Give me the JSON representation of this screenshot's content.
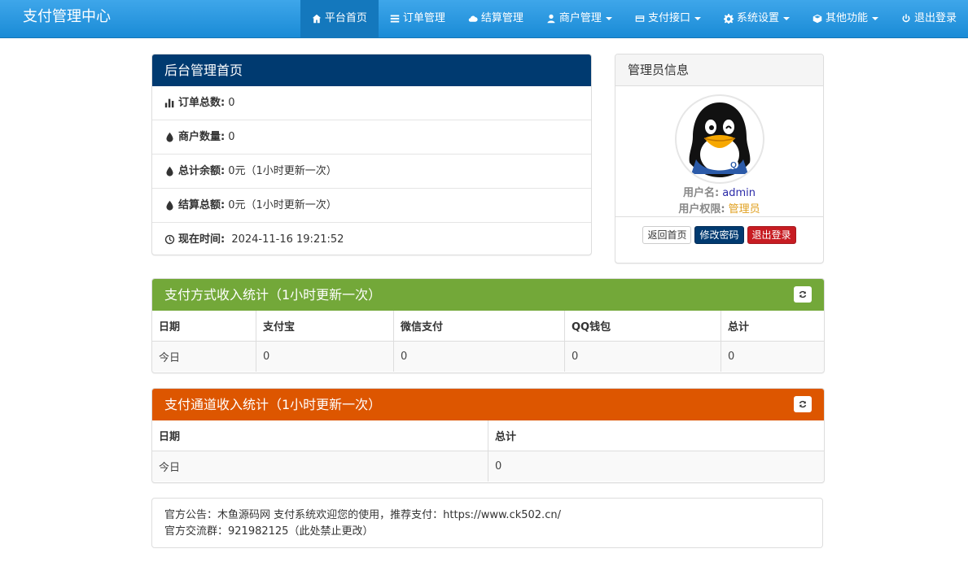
{
  "nav": {
    "brand": "支付管理中心",
    "items": [
      {
        "label": "平台首页",
        "icon": "home-icon",
        "active": true,
        "dropdown": false
      },
      {
        "label": "订单管理",
        "icon": "list-icon",
        "active": false,
        "dropdown": false
      },
      {
        "label": "结算管理",
        "icon": "cloud-icon",
        "active": false,
        "dropdown": false
      },
      {
        "label": "商户管理",
        "icon": "user-icon",
        "active": false,
        "dropdown": true
      },
      {
        "label": "支付接口",
        "icon": "credit-card-icon",
        "active": false,
        "dropdown": true
      },
      {
        "label": "系统设置",
        "icon": "gear-icon",
        "active": false,
        "dropdown": true
      },
      {
        "label": "其他功能",
        "icon": "cube-icon",
        "active": false,
        "dropdown": true
      },
      {
        "label": "退出登录",
        "icon": "power-icon",
        "active": false,
        "dropdown": false
      }
    ]
  },
  "dashboard": {
    "title": "后台管理首页",
    "items": [
      {
        "label": "订单总数:",
        "value": "0",
        "icon": "bar-chart-icon"
      },
      {
        "label": "商户数量:",
        "value": "0",
        "icon": "drop-icon"
      },
      {
        "label": "总计余额:",
        "value": "0元（1小时更新一次）",
        "icon": "drop-icon"
      },
      {
        "label": "结算总额:",
        "value": "0元（1小时更新一次）",
        "icon": "drop-icon"
      },
      {
        "label": "现在时间:",
        "value": " 2024-11-16 19:21:52",
        "icon": "clock-icon"
      }
    ]
  },
  "admin": {
    "title": "管理员信息",
    "username_label": "用户名:",
    "username": "admin",
    "role_label": "用户权限:",
    "role": "管理员",
    "btn_home": "返回首页",
    "btn_password": "修改密码",
    "btn_logout": "退出登录"
  },
  "pay_method": {
    "title": "支付方式收入统计（1小时更新一次）",
    "headers": [
      "日期",
      "支付宝",
      "微信支付",
      "QQ钱包",
      "总计"
    ],
    "row": [
      "今日",
      "0",
      "0",
      "0",
      "0"
    ]
  },
  "pay_channel": {
    "title": "支付通道收入统计（1小时更新一次）",
    "headers": [
      "日期",
      "总计"
    ],
    "row": [
      "今日",
      "0"
    ]
  },
  "notice": {
    "line1": "官方公告：木鱼源码网 支付系统欢迎您的使用，推荐支付：https://www.ck502.cn/",
    "line2": "官方交流群：921982125（此处禁止更改）"
  },
  "colors": {
    "nav": "#1a8bd6",
    "blue_heading": "#003a70",
    "green_heading": "#73a839",
    "orange_heading": "#dd5600"
  }
}
